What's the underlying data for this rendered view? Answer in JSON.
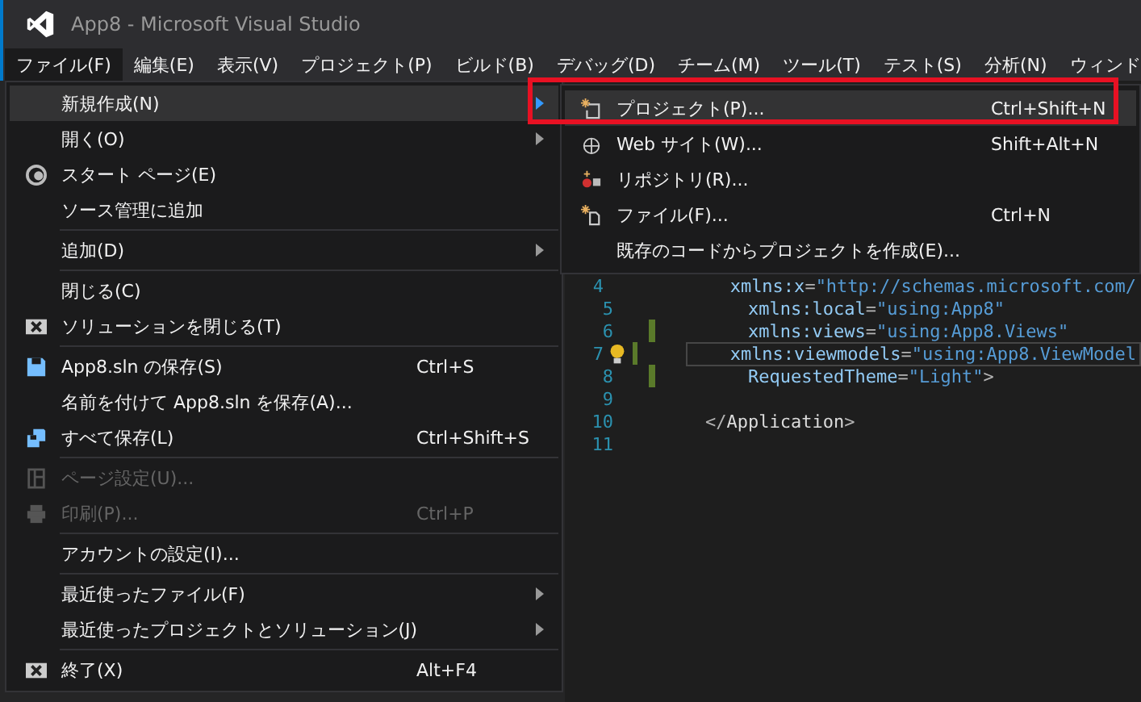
{
  "window": {
    "title": "App8 - Microsoft Visual Studio"
  },
  "menubar": [
    {
      "label": "ファイル(F)",
      "selected": true
    },
    {
      "label": "編集(E)",
      "selected": false
    },
    {
      "label": "表示(V)",
      "selected": false
    },
    {
      "label": "プロジェクト(P)",
      "selected": false
    },
    {
      "label": "ビルド(B)",
      "selected": false
    },
    {
      "label": "デバッグ(D)",
      "selected": false
    },
    {
      "label": "チーム(M)",
      "selected": false
    },
    {
      "label": "ツール(T)",
      "selected": false
    },
    {
      "label": "テスト(S)",
      "selected": false
    },
    {
      "label": "分析(N)",
      "selected": false
    },
    {
      "label": "ウィンド",
      "selected": false
    }
  ],
  "file_menu": {
    "groups": [
      [
        {
          "label": "新規作成(N)",
          "submenu": true,
          "highlighted": true,
          "disabled": false
        },
        {
          "label": "開く(O)",
          "submenu": true,
          "highlighted": false,
          "disabled": false
        },
        {
          "label": "スタート ページ(E)",
          "highlighted": false,
          "disabled": false
        },
        {
          "label": "ソース管理に追加",
          "highlighted": false,
          "disabled": false
        }
      ],
      [
        {
          "label": "追加(D)",
          "submenu": true,
          "highlighted": false,
          "disabled": false
        }
      ],
      [
        {
          "label": "閉じる(C)",
          "highlighted": false,
          "disabled": false
        },
        {
          "label": "ソリューションを閉じる(T)",
          "highlighted": false,
          "disabled": false
        }
      ],
      [
        {
          "label": "App8.sln の保存(S)",
          "shortcut": "Ctrl+S",
          "highlighted": false,
          "disabled": false
        },
        {
          "label": "名前を付けて App8.sln を保存(A)...",
          "highlighted": false,
          "disabled": false
        },
        {
          "label": "すべて保存(L)",
          "shortcut": "Ctrl+Shift+S",
          "highlighted": false,
          "disabled": false
        }
      ],
      [
        {
          "label": "ページ設定(U)...",
          "highlighted": false,
          "disabled": true
        },
        {
          "label": "印刷(P)...",
          "shortcut": "Ctrl+P",
          "highlighted": false,
          "disabled": true
        }
      ],
      [
        {
          "label": "アカウントの設定(I)...",
          "highlighted": false,
          "disabled": false
        }
      ],
      [
        {
          "label": "最近使ったファイル(F)",
          "submenu": true,
          "highlighted": false,
          "disabled": false
        },
        {
          "label": "最近使ったプロジェクトとソリューション(J)",
          "submenu": true,
          "highlighted": false,
          "disabled": false
        }
      ],
      [
        {
          "label": "終了(X)",
          "shortcut": "Alt+F4",
          "highlighted": false,
          "disabled": false
        }
      ]
    ]
  },
  "new_submenu": {
    "items": [
      {
        "label": "プロジェクト(P)...",
        "shortcut": "Ctrl+Shift+N",
        "highlighted": true
      },
      {
        "label": "Web サイト(W)...",
        "shortcut": "Shift+Alt+N",
        "highlighted": false
      },
      {
        "label": "リポジトリ(R)...",
        "highlighted": false
      },
      {
        "label": "ファイル(F)...",
        "shortcut": "Ctrl+N",
        "highlighted": false
      },
      {
        "label": "既存のコードからプロジェクトを作成(E)...",
        "highlighted": false
      }
    ]
  },
  "editor": {
    "lines": [
      {
        "number": "4",
        "changed": false,
        "current": false,
        "tokens": [
          {
            "kind": "attr",
            "text": "    xmlns:x"
          },
          {
            "kind": "punct",
            "text": "="
          },
          {
            "kind": "string",
            "text": "\"http://schemas.microsoft.com/"
          }
        ]
      },
      {
        "number": "5",
        "changed": false,
        "current": false,
        "tokens": [
          {
            "kind": "attr",
            "text": "    xmlns:local"
          },
          {
            "kind": "punct",
            "text": "="
          },
          {
            "kind": "string",
            "text": "\"using:App8\""
          }
        ]
      },
      {
        "number": "6",
        "changed": true,
        "current": false,
        "tokens": [
          {
            "kind": "attr",
            "text": "    xmlns:views"
          },
          {
            "kind": "punct",
            "text": "="
          },
          {
            "kind": "string",
            "text": "\"using:App8.Views\""
          }
        ]
      },
      {
        "number": "7",
        "changed": true,
        "current": true,
        "tokens": [
          {
            "kind": "attr",
            "text": "    xmlns:viewmodels"
          },
          {
            "kind": "punct",
            "text": "="
          },
          {
            "kind": "string",
            "text": "\"using:App8.ViewModel"
          }
        ]
      },
      {
        "number": "8",
        "changed": true,
        "current": false,
        "tokens": [
          {
            "kind": "attr",
            "text": "    RequestedTheme"
          },
          {
            "kind": "punct",
            "text": "="
          },
          {
            "kind": "string",
            "text": "\"Light\""
          },
          {
            "kind": "punct",
            "text": ">"
          }
        ]
      },
      {
        "number": "9",
        "changed": false,
        "current": false
      },
      {
        "number": "10",
        "changed": false,
        "current": false,
        "tokens": [
          {
            "kind": "punct",
            "text": "</"
          },
          {
            "kind": "tag",
            "text": "Application"
          },
          {
            "kind": "punct",
            "text": ">"
          }
        ]
      },
      {
        "number": "11",
        "changed": false,
        "current": false
      }
    ]
  }
}
